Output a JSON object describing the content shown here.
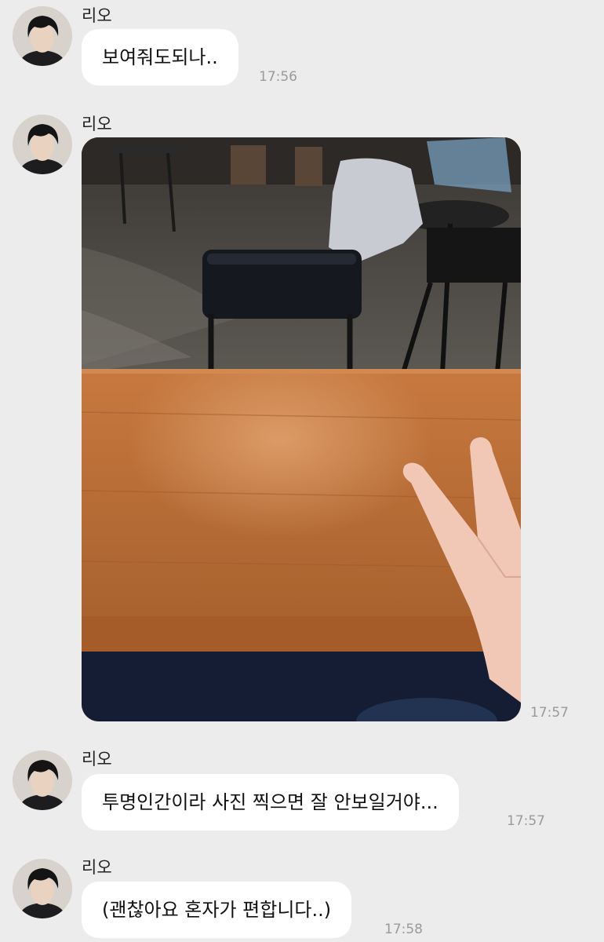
{
  "messages": [
    {
      "sender": "리오",
      "type": "text",
      "text": "보여줘도되나..",
      "time": "17:56",
      "avatar_icon": "profile-photo-icon"
    },
    {
      "sender": "리오",
      "type": "image",
      "image_description": "cafe-table-peace-sign-photo",
      "time": "17:57",
      "avatar_icon": "profile-photo-icon"
    },
    {
      "sender": "리오",
      "type": "text",
      "text": "투명인간이라 사진 찍으면 잘 안보일거야...",
      "time": "17:57",
      "avatar_icon": "profile-photo-icon"
    },
    {
      "sender": "리오",
      "type": "text",
      "text": "(괜찮아요 혼자가 편합니다..)",
      "time": "17:58",
      "avatar_icon": "profile-photo-icon"
    }
  ],
  "colors": {
    "background": "#ececec",
    "bubble": "#ffffff",
    "timestamp": "#9a9a9a"
  }
}
